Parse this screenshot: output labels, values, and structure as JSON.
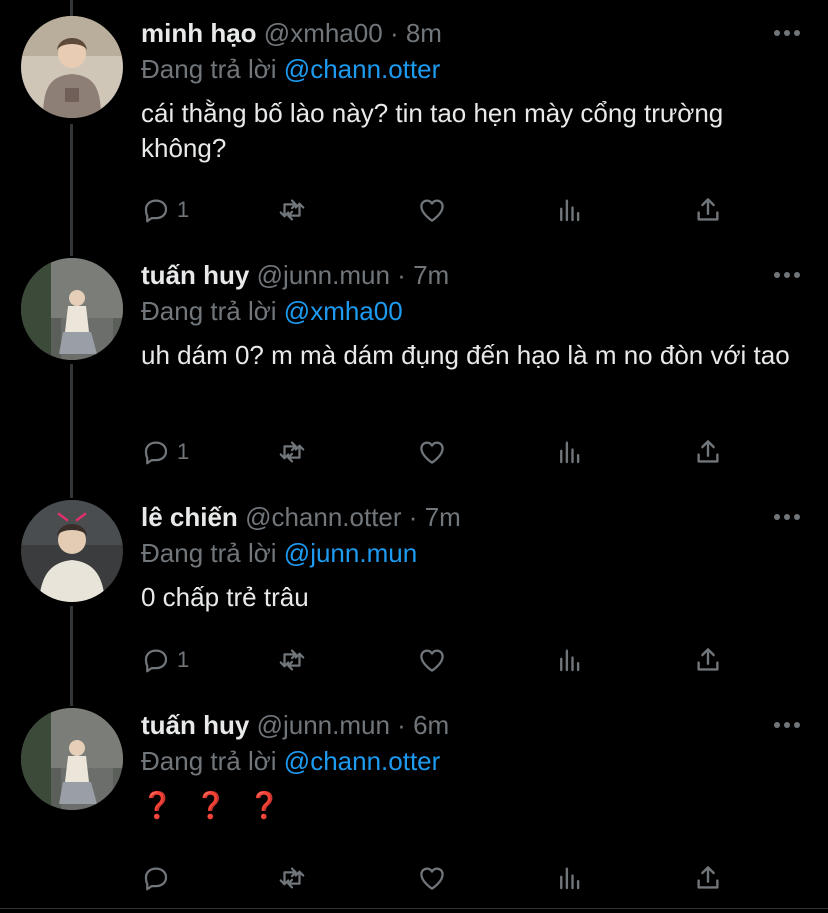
{
  "colors": {
    "background": "#000000",
    "name": "#e7e9ea",
    "muted": "#71767b",
    "mention": "#1d9bf0",
    "question_marks": "#e0161b"
  },
  "tweets": [
    {
      "name": "minh hạo",
      "handle": "@xmha00",
      "dot": "·",
      "time": "8m",
      "replying_prefix": "Đang trả lời",
      "replying_to": "@chann.otter",
      "text": "cái thằng bố lào này? tin tao hẹn mày cổng trường không?",
      "reply_count": "1",
      "avatar": "avatar-hoodie"
    },
    {
      "name": "tuấn huy",
      "handle": "@junn.mun",
      "dot": "·",
      "time": "7m",
      "replying_prefix": "Đang trả lời",
      "replying_to": "@xmha00",
      "text": "uh dám 0? m mà dám đụng đến hạo là m no đòn với tao",
      "reply_count": "1",
      "avatar": "avatar-sitting"
    },
    {
      "name": "lê chiến",
      "handle": "@chann.otter",
      "dot": "·",
      "time": "7m",
      "replying_prefix": "Đang trả lời",
      "replying_to": "@junn.mun",
      "text": "0 chấp trẻ trâu",
      "reply_count": "1",
      "avatar": "avatar-sweater"
    },
    {
      "name": "tuấn huy",
      "handle": "@junn.mun",
      "dot": "·",
      "time": "6m",
      "replying_prefix": "Đang trả lời",
      "replying_to": "@chann.otter",
      "text": "❓ ❓ ❓",
      "reply_count": "",
      "avatar": "avatar-sitting"
    }
  ],
  "icons": [
    "reply-icon",
    "retweet-icon",
    "like-icon",
    "views-icon",
    "share-icon",
    "more-icon"
  ]
}
